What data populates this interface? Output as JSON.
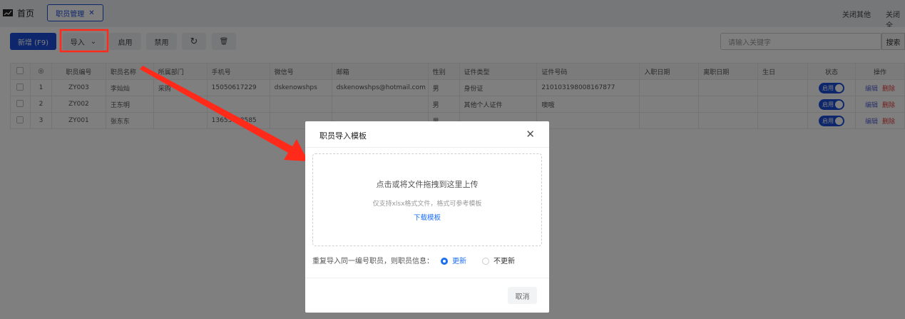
{
  "header": {
    "home": "首页",
    "tab": "职员管理",
    "close_others": "关闭其他",
    "close_all": "关闭全"
  },
  "toolbar": {
    "add": "新增 (F9)",
    "import": "导入",
    "enable": "启用",
    "disable": "禁用",
    "search_placeholder": "请输入关键字",
    "search": "搜索"
  },
  "table": {
    "columns": [
      "职员编号",
      "职员名称",
      "所属部门",
      "手机号",
      "微信号",
      "邮箱",
      "性别",
      "证件类型",
      "证件号码",
      "入职日期",
      "离职日期",
      "生日",
      "状态",
      "操作"
    ],
    "rows": [
      {
        "idx": "1",
        "code": "ZY003",
        "name": "李灿灿",
        "dept": "采购",
        "phone": "15050617229",
        "wechat": "dskenowshps",
        "email": "dskenowshps@hotmail.com",
        "gender": "男",
        "idtype": "身份证",
        "idno": "210103198008167877"
      },
      {
        "idx": "2",
        "code": "ZY002",
        "name": "王东明",
        "dept": "",
        "phone": "",
        "wechat": "",
        "email": "",
        "gender": "男",
        "idtype": "其他个人证件",
        "idno": "噢哦"
      },
      {
        "idx": "3",
        "code": "ZY001",
        "name": "张东东",
        "dept": "",
        "phone": "13655858585",
        "wechat": "",
        "email": "",
        "gender": "男",
        "idtype": "",
        "idno": ""
      }
    ],
    "status_label": "启用",
    "edit": "编辑",
    "delete": "删除"
  },
  "dialog": {
    "title": "职员导入模板",
    "upload_main": "点击或将文件拖拽到这里上传",
    "upload_hint": "仅支持xlsx格式文件，格式可参考模板",
    "download": "下载模板",
    "dup_label": "重复导入同一编号职员，则职员信息：",
    "opt_update": "更新",
    "opt_no_update": "不更新",
    "cancel": "取消"
  },
  "colors": {
    "primary": "#1d4ed8",
    "annotation": "#ff2a1a"
  }
}
